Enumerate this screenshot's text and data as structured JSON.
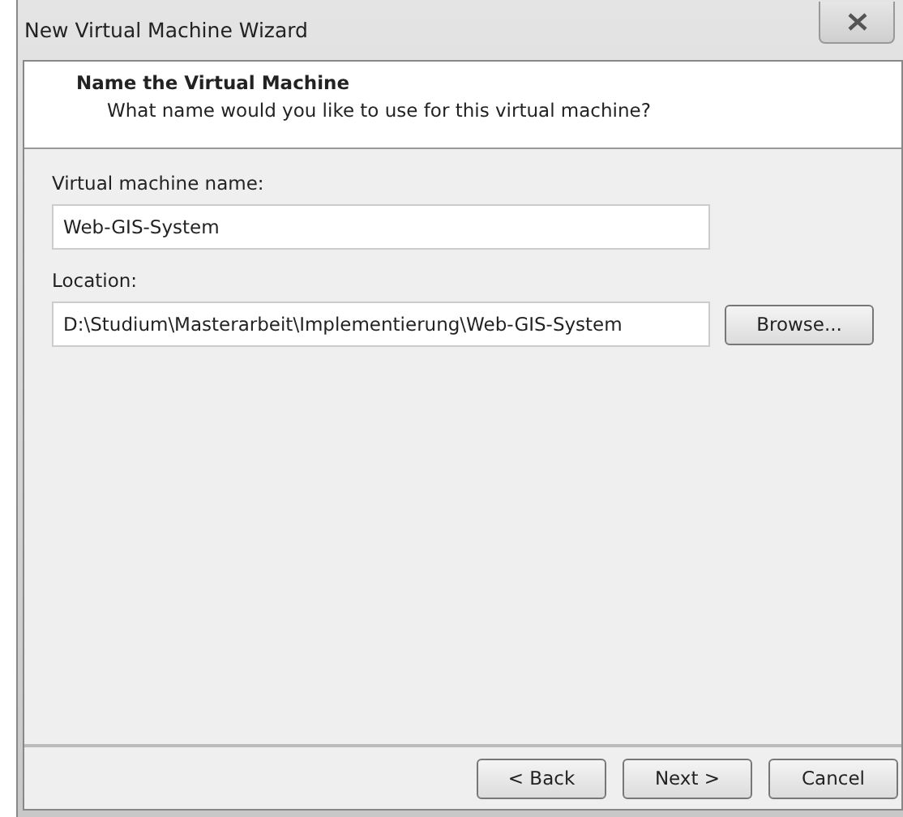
{
  "window": {
    "title": "New Virtual Machine Wizard"
  },
  "header": {
    "title": "Name the Virtual Machine",
    "subtitle": "What name would you like to use for this virtual machine?"
  },
  "fields": [
    {
      "label": "Virtual machine name:",
      "value": "Web-GIS-System"
    },
    {
      "label": "Location:",
      "value": "D:\\Studium\\Masterarbeit\\Implementierung\\Web-GIS-System",
      "button": "Browse..."
    }
  ],
  "buttons": [
    "< Back",
    "Next >",
    "Cancel"
  ]
}
